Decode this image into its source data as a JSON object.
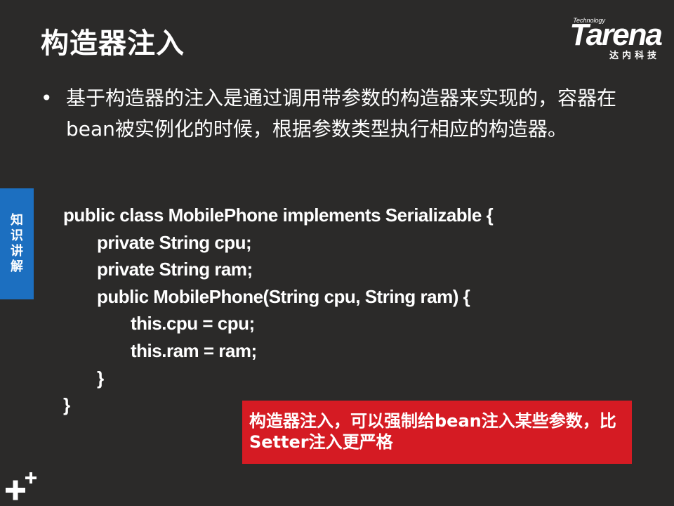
{
  "slide": {
    "title": "构造器注入",
    "logo": {
      "small_text": "Technology",
      "word": "Tarena",
      "sub": "达内科技"
    },
    "bullet": {
      "marker": "•",
      "text": "基于构造器的注入是通过调用带参数的构造器来实现的，容器在bean被实例化的时候，根据参数类型执行相应的构造器。"
    },
    "side_tab": {
      "chars": [
        "知",
        "识",
        "讲",
        "解"
      ]
    },
    "code_lines": [
      "public class MobilePhone implements Serializable {",
      "private String cpu;",
      "private String ram;",
      "public MobilePhone(String cpu, String ram) {",
      "this.cpu = cpu;",
      "this.ram = ram;",
      "}",
      "}"
    ],
    "callout": {
      "text": "构造器注入，可以强制给bean注入某些参数，比Setter注入更严格"
    }
  },
  "colors": {
    "background": "#2b2a29",
    "side_tab": "#1c6fc0",
    "callout": "#d51b23",
    "text": "#ffffff"
  }
}
